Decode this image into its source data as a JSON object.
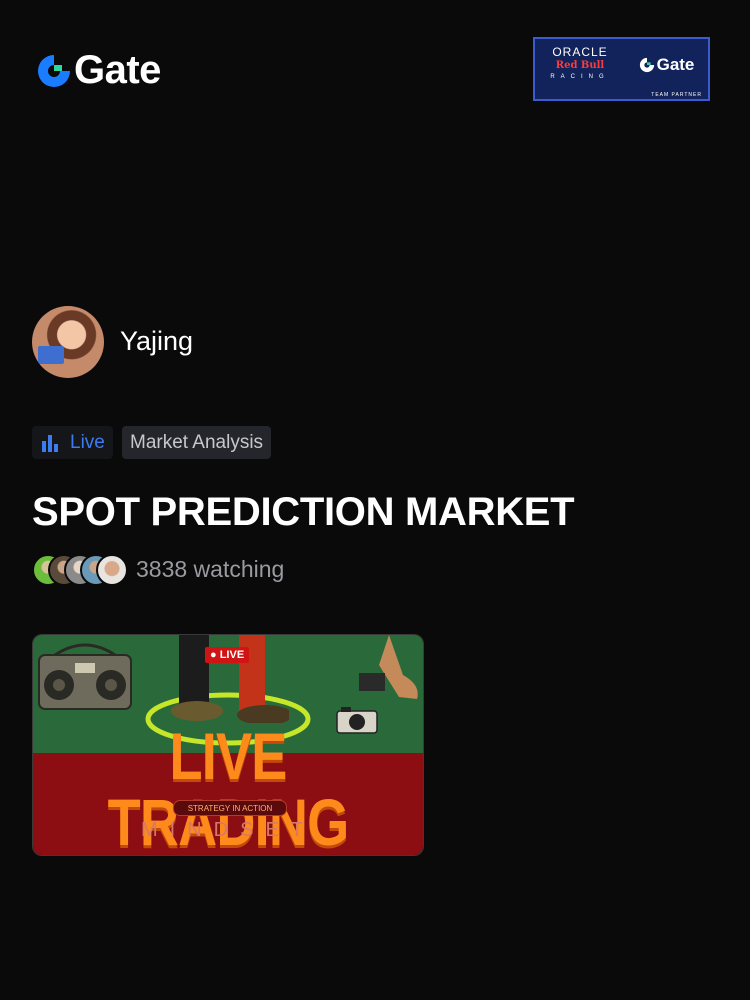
{
  "brand": {
    "name": "Gate",
    "color": "#1a7cff"
  },
  "partner": {
    "oracle": "ORACLE",
    "team": "Red Bull",
    "racing": "RACING",
    "brand": "Gate",
    "footer": "TEAM PARTNER"
  },
  "host": {
    "name": "Yajing"
  },
  "tags": {
    "live": "Live",
    "category": "Market Analysis"
  },
  "stream": {
    "title": "SPOT PREDICTION MARKET",
    "watching": "3838 watching"
  },
  "thumbnail": {
    "badge": "LIVE",
    "headline": "LIVE TRADING",
    "pill": "STRATEGY IN ACTION",
    "subline": "MINDSET"
  },
  "colors": {
    "accent": "#3d7cf0",
    "background": "#0a0a0b",
    "live_red": "#d01414"
  },
  "icons": [
    "gate-logo-icon",
    "bar-chart-icon",
    "viewer-avatar"
  ]
}
